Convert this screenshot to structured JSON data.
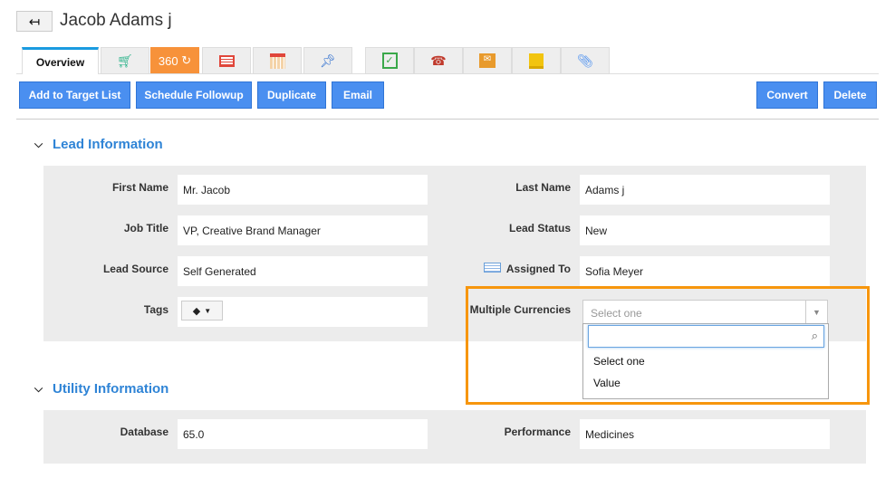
{
  "header": {
    "back_icon": "arrow-left-icon",
    "title": "Jacob Adams j"
  },
  "tabs": [
    {
      "label": "Overview"
    },
    {
      "icon": "cart-icon"
    },
    {
      "label": "360",
      "icon": "refresh-icon"
    },
    {
      "icon": "newspaper-icon"
    },
    {
      "icon": "calendar-icon"
    },
    {
      "icon": "pin-icon"
    },
    {
      "icon": "task-check-icon"
    },
    {
      "icon": "phone-icon"
    },
    {
      "icon": "mail-icon"
    },
    {
      "icon": "note-icon"
    },
    {
      "icon": "paperclip-icon"
    }
  ],
  "actions": {
    "add_target": "Add to Target List",
    "schedule": "Schedule Followup",
    "duplicate": "Duplicate",
    "email": "Email",
    "convert": "Convert",
    "delete": "Delete"
  },
  "lead": {
    "heading": "Lead Information",
    "first_name_label": "First Name",
    "first_name": "Mr. Jacob",
    "last_name_label": "Last Name",
    "last_name": "Adams j",
    "job_title_label": "Job Title",
    "job_title": "VP, Creative Brand Manager",
    "lead_status_label": "Lead Status",
    "lead_status": "New",
    "lead_source_label": "Lead Source",
    "lead_source": "Self Generated",
    "assigned_label": "Assigned To",
    "assigned": "Sofia Meyer",
    "tags_label": "Tags",
    "currencies_label": "Multiple Currencies",
    "currencies_placeholder": "Select one",
    "currencies_options": [
      "Select one",
      "Value"
    ]
  },
  "utility": {
    "heading": "Utility Information",
    "database_label": "Database",
    "database": "65.0",
    "performance_label": "Performance",
    "performance": "Medicines"
  },
  "colors": {
    "accent": "#4a8ff0",
    "highlight": "#f7960d",
    "tab_360": "#f7923a"
  }
}
